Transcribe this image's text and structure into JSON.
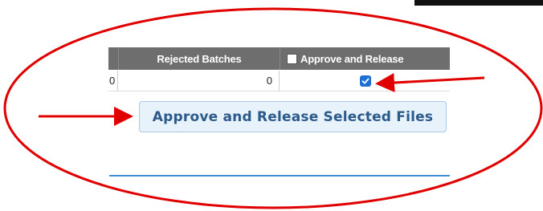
{
  "table": {
    "columns": [
      "",
      "Rejected Batches",
      "Approve and Release"
    ],
    "rows": [
      {
        "partial_cell": "0",
        "rejected_batches": "0",
        "approve_checked": true
      }
    ]
  },
  "actions": {
    "release_button_label": "Approve and Release Selected Files"
  },
  "annotations": {
    "color": "#e00000",
    "shapes": [
      "ellipse",
      "arrow-to-checkbox",
      "arrow-to-button"
    ]
  }
}
